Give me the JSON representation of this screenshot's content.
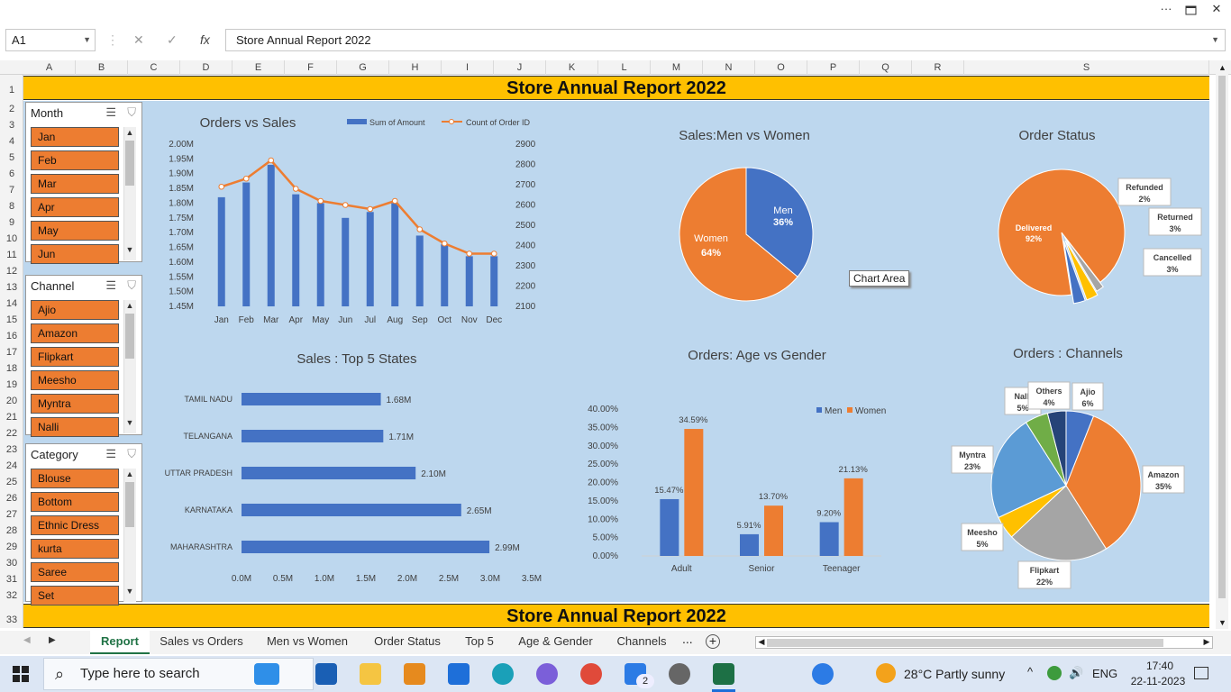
{
  "window": {
    "more": "···",
    "restore_icon": "restore-icon",
    "close": "✕"
  },
  "formula_bar": {
    "name_box": "A1",
    "content": "Store Annual Report 2022",
    "fx": "fx",
    "cancel": "✕",
    "enter": "✓"
  },
  "columns": [
    "A",
    "B",
    "C",
    "D",
    "E",
    "F",
    "G",
    "H",
    "I",
    "J",
    "K",
    "L",
    "M",
    "N",
    "O",
    "P",
    "Q",
    "R",
    "S"
  ],
  "rows": [
    "1",
    "2",
    "3",
    "4",
    "5",
    "6",
    "7",
    "8",
    "9",
    "10",
    "11",
    "12",
    "13",
    "14",
    "15",
    "16",
    "17",
    "18",
    "19",
    "20",
    "21",
    "22",
    "23",
    "24",
    "25",
    "26",
    "27",
    "28",
    "29",
    "30",
    "31",
    "32",
    "33"
  ],
  "banner": {
    "top": "Store Annual Report 2022",
    "bottom": "Store Annual Report 2022"
  },
  "slicers": [
    {
      "title": "Month",
      "items": [
        "Jan",
        "Feb",
        "Mar",
        "Apr",
        "May",
        "Jun"
      ]
    },
    {
      "title": "Channel",
      "items": [
        "Ajio",
        "Amazon",
        "Flipkart",
        "Meesho",
        "Myntra",
        "Nalli"
      ]
    },
    {
      "title": "Category",
      "items": [
        "Blouse",
        "Bottom",
        "Ethnic Dress",
        "kurta",
        "Saree",
        "Set"
      ]
    }
  ],
  "tooltip": "Chart Area",
  "chart_data": [
    {
      "type": "bar+line",
      "title": "Orders vs Sales",
      "categories": [
        "Jan",
        "Feb",
        "Mar",
        "Apr",
        "May",
        "Jun",
        "Jul",
        "Aug",
        "Sep",
        "Oct",
        "Nov",
        "Dec"
      ],
      "series": [
        {
          "name": "Sum of Amount",
          "type": "bar",
          "axis": "left",
          "color": "#4472c4",
          "values": [
            1.82,
            1.87,
            1.93,
            1.83,
            1.8,
            1.75,
            1.77,
            1.8,
            1.69,
            1.66,
            1.62,
            1.62
          ]
        },
        {
          "name": "Count of Order ID",
          "type": "line",
          "axis": "right",
          "color": "#ed7d31",
          "values": [
            2690,
            2730,
            2820,
            2680,
            2620,
            2600,
            2580,
            2620,
            2480,
            2410,
            2360,
            2360
          ]
        }
      ],
      "y_left": {
        "ticks": [
          "2.00M",
          "1.95M",
          "1.90M",
          "1.85M",
          "1.80M",
          "1.75M",
          "1.70M",
          "1.65M",
          "1.60M",
          "1.55M",
          "1.50M",
          "1.45M"
        ],
        "range": [
          1.45,
          2.0
        ]
      },
      "y_right": {
        "ticks": [
          "2900",
          "2800",
          "2700",
          "2600",
          "2500",
          "2400",
          "2300",
          "2200",
          "2100"
        ],
        "range": [
          2100,
          2900
        ]
      },
      "legend": "top"
    },
    {
      "type": "pie",
      "title": "Sales:Men vs Women",
      "slices": [
        {
          "label": "Men",
          "value": 36,
          "text": "36%",
          "color": "#4472c4"
        },
        {
          "label": "Women",
          "value": 64,
          "text": "64%",
          "color": "#ed7d31"
        }
      ]
    },
    {
      "type": "pie",
      "title": "Order Status",
      "slices": [
        {
          "label": "Delivered",
          "value": 92,
          "text": "92%",
          "color": "#ed7d31"
        },
        {
          "label": "Refunded",
          "value": 2,
          "text": "2%",
          "color": "#a5a5a5"
        },
        {
          "label": "Returned",
          "value": 3,
          "text": "3%",
          "color": "#ffc000"
        },
        {
          "label": "Cancelled",
          "value": 3,
          "text": "3%",
          "color": "#4472c4"
        }
      ]
    },
    {
      "type": "bar",
      "orientation": "horizontal",
      "title": "Sales : Top 5 States",
      "categories": [
        "TAMIL NADU",
        "TELANGANA",
        "UTTAR PRADESH",
        "KARNATAKA",
        "MAHARASHTRA"
      ],
      "values": [
        1.68,
        1.71,
        2.1,
        2.65,
        2.99
      ],
      "labels": [
        "1.68M",
        "1.71M",
        "2.10M",
        "2.65M",
        "2.99M"
      ],
      "x_ticks": [
        "0.0M",
        "0.5M",
        "1.0M",
        "1.5M",
        "2.0M",
        "2.5M",
        "3.0M",
        "3.5M"
      ],
      "xlim": [
        0,
        3.5
      ]
    },
    {
      "type": "bar",
      "title": "Orders: Age vs Gender",
      "categories": [
        "Adult",
        "Senior",
        "Teenager"
      ],
      "series": [
        {
          "name": "Men",
          "color": "#4472c4",
          "values": [
            15.47,
            5.91,
            9.2
          ],
          "labels": [
            "15.47%",
            "5.91%",
            "9.20%"
          ]
        },
        {
          "name": "Women",
          "color": "#ed7d31",
          "values": [
            34.59,
            13.7,
            21.13
          ],
          "labels": [
            "34.59%",
            "13.70%",
            "21.13%"
          ]
        }
      ],
      "y_ticks": [
        "40.00%",
        "35.00%",
        "30.00%",
        "25.00%",
        "20.00%",
        "15.00%",
        "10.00%",
        "5.00%",
        "0.00%"
      ],
      "ylim": [
        0,
        40
      ],
      "legend": "top-right"
    },
    {
      "type": "pie",
      "title": "Orders : Channels",
      "slices": [
        {
          "label": "Ajio",
          "value": 6,
          "text": "6%",
          "color": "#4472c4"
        },
        {
          "label": "Amazon",
          "value": 35,
          "text": "35%",
          "color": "#ed7d31"
        },
        {
          "label": "Flipkart",
          "value": 22,
          "text": "22%",
          "color": "#a5a5a5"
        },
        {
          "label": "Meesho",
          "value": 5,
          "text": "5%",
          "color": "#ffc000"
        },
        {
          "label": "Myntra",
          "value": 23,
          "text": "23%",
          "color": "#5b9bd5"
        },
        {
          "label": "Nalli",
          "value": 5,
          "text": "5%",
          "color": "#70ad47"
        },
        {
          "label": "Others",
          "value": 4,
          "text": "4%",
          "color": "#264478"
        }
      ]
    }
  ],
  "sheet_tabs": {
    "tabs": [
      "Report",
      "Sales vs Orders",
      "Men vs Women",
      "Order Status",
      "Top 5",
      "Age & Gender",
      "Channels"
    ],
    "more": "...",
    "active": "Report"
  },
  "taskbar": {
    "search": "Type here to search",
    "weather": "28°C  Partly sunny",
    "lang": "ENG",
    "time": "17:40",
    "date": "22-11-2023",
    "chrome_badge": "2"
  }
}
